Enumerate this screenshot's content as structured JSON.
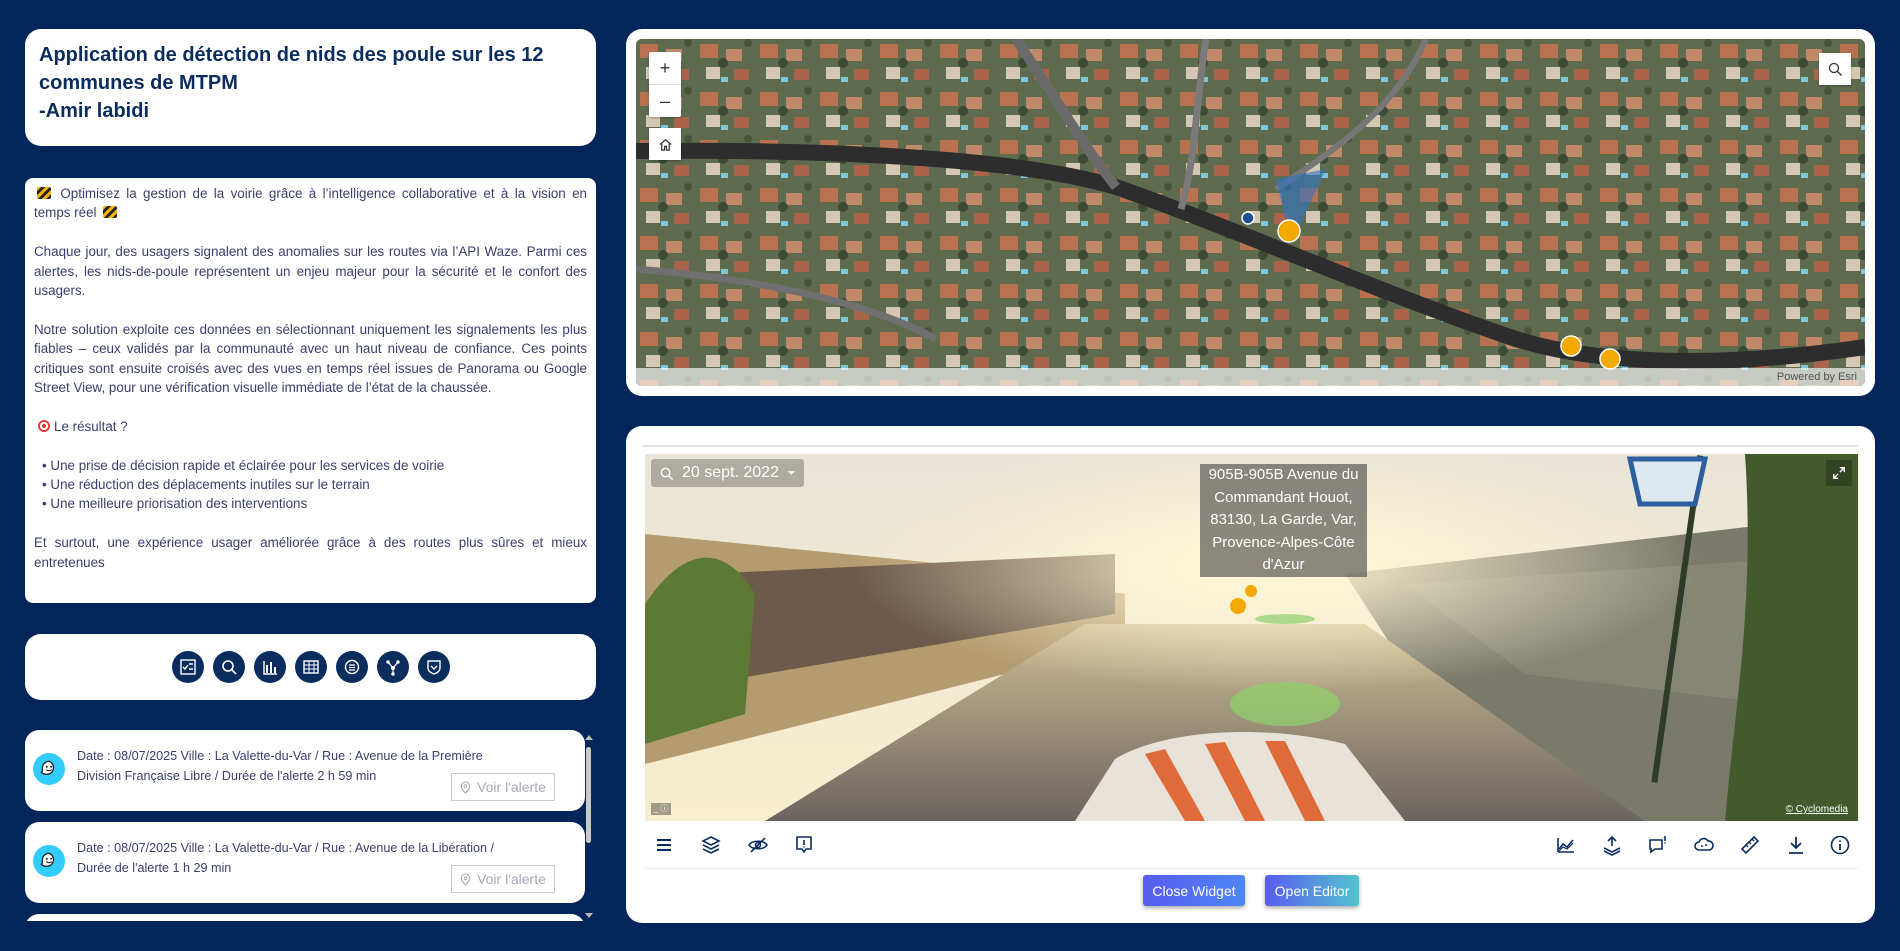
{
  "title": {
    "text": "Application de détection de nids des poule sur les 12\ncommunes de MTPM\n-Amir labidi"
  },
  "description": {
    "intro": "Optimisez la gestion de la voirie grâce à l’intelligence collaborative et à la vision en temps réel",
    "p1": "Chaque jour, des usagers signalent des anomalies sur les routes via l’API Waze. Parmi ces alertes, les nids-de-poule représentent un enjeu majeur pour la sécurité et le confort des usagers.",
    "p2": "Notre solution exploite ces données en sélectionnant uniquement les signalements les plus fiables – ceux validés par la communauté avec un haut niveau de confiance. Ces points critiques sont ensuite croisés avec des vues en temps réel issues de Panorama ou Google Street View, pour une vérification visuelle immédiate de l’état de la chaussée.",
    "result_heading": "Le résultat ?",
    "bullets": [
      "Une prise de décision rapide et éclairée pour les services de voirie",
      "Une réduction des déplacements inutiles sur le terrain",
      "Une meilleure priorisation des interventions"
    ],
    "conclusion": "Et surtout, une expérience usager améliorée grâce à des routes plus sûres et mieux entretenues"
  },
  "tools": [
    "checklist-icon",
    "search-icon",
    "bar-chart-icon",
    "table-icon",
    "list-icon",
    "network-icon",
    "shield-icon"
  ],
  "alerts": [
    {
      "line1": "Date : 08/07/2025  Ville :  La Valette-du-Var /   Rue :  Avenue de la Première",
      "line2": "Division Française Libre  / Durée de l'alerte  2 h 59 min",
      "button": "Voir l'alerte"
    },
    {
      "line1": "Date : 08/07/2025  Ville :  La Valette-du-Var /   Rue :  Avenue de la Libération  /",
      "line2": "Durée de l'alerte  1 h 29 min",
      "button": "Voir l'alerte"
    }
  ],
  "map": {
    "zoom_in": "+",
    "zoom_out": "–",
    "attribution": "Powered by Esri"
  },
  "streetview": {
    "date": "20 sept. 2022",
    "address": "905B-905B Avenue du Commandant Houot, 83130, La Garde, Var, Provence-Alpes-Côte d'Azur",
    "credit": "© Cyclomedia",
    "mini_label": "_ ⓘ",
    "toolbar_left": [
      "menu-icon",
      "layers-icon",
      "visibility-off-icon",
      "report-icon"
    ],
    "toolbar_right": [
      "elevation-icon",
      "upload-icon",
      "comment-alert-icon",
      "pointcloud-icon",
      "measure-icon",
      "download-icon",
      "info-icon"
    ]
  },
  "buttons": {
    "close": "Close Widget",
    "open": "Open Editor"
  },
  "colors": {
    "background": "#03265a",
    "accent": "#0b2d5e",
    "waze": "#33ccff",
    "alert_marker": "#f2a900"
  }
}
